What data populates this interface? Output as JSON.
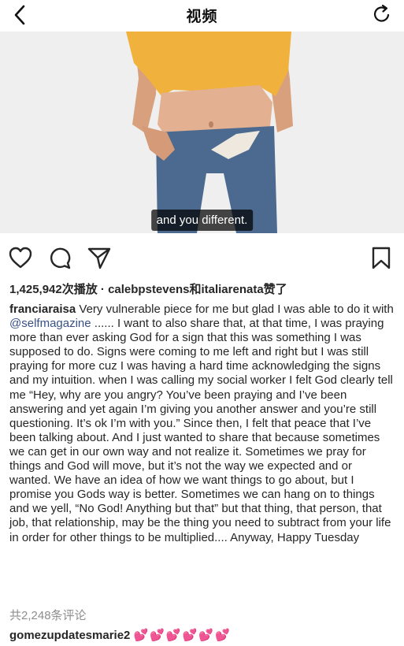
{
  "header": {
    "title": "视频",
    "back_icon": "chevron-left-icon",
    "refresh_icon": "refresh-icon"
  },
  "video": {
    "subtitle": "and you different."
  },
  "actions": {
    "icons": [
      "heart-icon",
      "comment-icon",
      "share-icon",
      "bookmark-icon"
    ]
  },
  "stats": {
    "views": "1,425,942次播放",
    "separator": " · ",
    "likes": "calebpstevens和italiarenata赞了"
  },
  "caption": {
    "username": "franciaraisa",
    "text_before_mention": " Very vulnerable piece for me but glad I was able to do it with ",
    "mention": "@selfmagazine",
    "text_after_mention": " ...... I want to also share that, at that time, I was praying more than ever asking God for a sign that this was something I was supposed to do. Signs were coming to me left and right but I was still praying for more cuz I was having a hard time acknowledging the signs and my intuition. when I was calling my social worker I felt God clearly tell me “Hey, why are you angry? You’ve been praying and I’ve been answering and yet again I’m giving you another answer and you’re still questioning. It’s ok I’m with you.” Since then, I felt that peace that I’ve been talking about. And I just wanted to share that because sometimes we can get in our own way and not realize it. Sometimes we pray for things and God will move, but it’s not the way we expected and or wanted. We have an idea of how we want things to go about, but I promise you Gods way is better. Sometimes we can hang on to things and we yell, “No God! Anything but that” but that thing, that person, that job, that relationship, may be the thing you need to subtract from your life in order for other things to be multiplied.... Anyway, Happy Tuesday"
  },
  "comments": {
    "count_label": "共2,248条评论",
    "first": {
      "username": "gomezupdatesmarie2",
      "text": "💕💕💕💕💕💕"
    }
  },
  "colors": {
    "mention": "#385185",
    "muted": "#8e8e8e",
    "text": "#262626"
  }
}
